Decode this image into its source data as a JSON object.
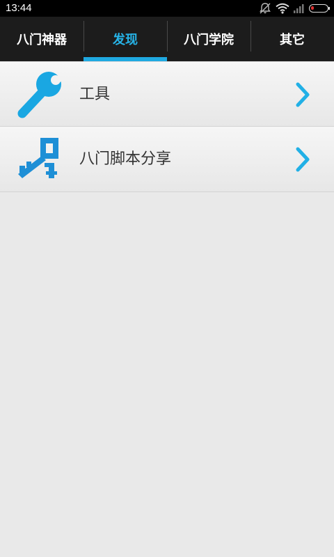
{
  "status_bar": {
    "time": "13:44",
    "icons": [
      "alarm-off-icon",
      "wifi-icon",
      "signal-icon",
      "battery-icon"
    ],
    "battery_color": "#e03030"
  },
  "tabs": [
    {
      "label": "八门神器",
      "active": false
    },
    {
      "label": "发现",
      "active": true
    },
    {
      "label": "八门学院",
      "active": false
    },
    {
      "label": "其它",
      "active": false
    }
  ],
  "accent_color": "#1fa9e1",
  "list": [
    {
      "label": "工具",
      "icon": "wrench-icon"
    },
    {
      "label": "八门脚本分享",
      "icon": "key-icon"
    }
  ]
}
